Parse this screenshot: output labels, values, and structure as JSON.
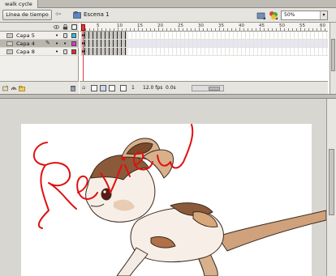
{
  "document": {
    "tab_title": "walk cycle"
  },
  "edit_bar": {
    "timeline_button": "Línea de tiempo",
    "scene_label": "Escena 1",
    "zoom_value": "50%"
  },
  "ruler": {
    "labels": [
      "1",
      "5",
      "10",
      "15",
      "20",
      "25",
      "30",
      "35",
      "40",
      "45",
      "50",
      "55",
      "60"
    ]
  },
  "layers": [
    {
      "name": "Capa 5",
      "selected": false,
      "color": "#22c6e6"
    },
    {
      "name": "Capa 4",
      "selected": true,
      "color": "#e030e8"
    },
    {
      "name": "Capa 8",
      "selected": false,
      "color": "#e82a2a"
    }
  ],
  "timeline_status": {
    "current_frame": "1",
    "frame_rate": "12.0 fps",
    "elapsed_time": "0.0s"
  },
  "annotation": {
    "colour": "#e01010"
  }
}
